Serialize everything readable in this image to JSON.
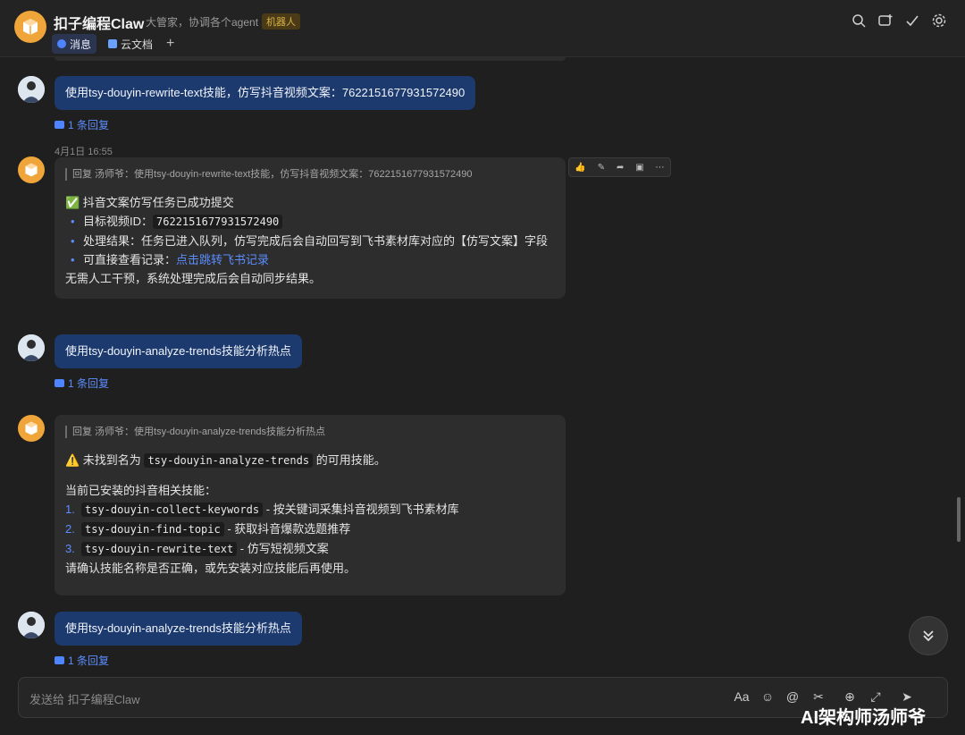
{
  "header": {
    "title": "扣子编程Claw",
    "subtitle": "大管家，协调各个agent",
    "badge": "机器人",
    "tabs": [
      {
        "label": "消息",
        "icon": "chat-icon"
      },
      {
        "label": "云文档",
        "icon": "doc-icon"
      }
    ],
    "add_tab": "+",
    "actions": [
      "search-icon",
      "add-chat-icon",
      "checkmark-icon",
      "gear-icon"
    ]
  },
  "messages": {
    "m1": {
      "text": "使用tsy-douyin-rewrite-text技能，仿写抖音视频文案：7622151677931572490",
      "reply_count": "1 条回复"
    },
    "timestamp": "4月1日 16:55",
    "m2": {
      "quote": "回复 汤师爷：使用tsy-douyin-rewrite-text技能，仿写抖音视频文案：7622151677931572490",
      "heading": "✅ 抖音文案仿写任务已成功提交",
      "items": [
        {
          "label": "目标视频ID：",
          "code": "7622151677931572490"
        },
        {
          "label": "处理结果：任务已进入队列，仿写完成后会自动回写到飞书素材库对应的【仿写文案】字段"
        },
        {
          "label": "可直接查看记录：",
          "link": "点击跳转飞书记录"
        }
      ],
      "footer": "无需人工干预，系统处理完成后会自动同步结果。"
    },
    "m3": {
      "text": "使用tsy-douyin-analyze-trends技能分析热点",
      "reply_count": "1 条回复"
    },
    "m4": {
      "quote": "回复 汤师爷：使用tsy-douyin-analyze-trends技能分析热点",
      "warn_pre": "⚠️ 未找到名为",
      "warn_code": "tsy-douyin-analyze-trends",
      "warn_post": "的可用技能。",
      "intro": "当前已安装的抖音相关技能：",
      "skills": [
        {
          "n": "1.",
          "code": "tsy-douyin-collect-keywords",
          "desc": "- 按关键词采集抖音视频到飞书素材库"
        },
        {
          "n": "2.",
          "code": "tsy-douyin-find-topic",
          "desc": "- 获取抖音爆款选题推荐"
        },
        {
          "n": "3.",
          "code": "tsy-douyin-rewrite-text",
          "desc": "- 仿写短视频文案"
        }
      ],
      "footer": "请确认技能名称是否正确，或先安装对应技能后再使用。"
    },
    "m5": {
      "text": "使用tsy-douyin-analyze-trends技能分析热点",
      "reply_count": "1 条回复"
    }
  },
  "hover_toolbar": [
    "thumbs-up-icon",
    "comment-icon",
    "forward-icon",
    "label-icon",
    "more-icon"
  ],
  "input": {
    "placeholder": "发送给 扣子编程Claw",
    "tools": [
      "font-format-icon",
      "emoji-icon",
      "mention-icon",
      "scissors-icon",
      "add-icon",
      "expand-icon",
      "send-icon"
    ]
  },
  "watermark": "AI架构师汤师爷"
}
